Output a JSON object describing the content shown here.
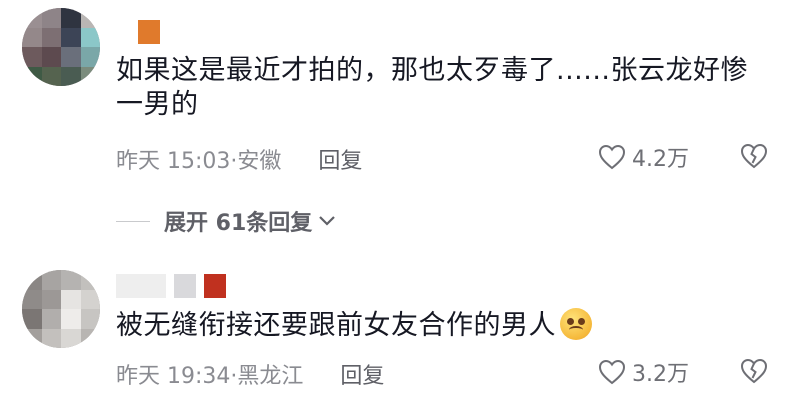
{
  "comments": [
    {
      "text": "如果这是最近才拍的，那也太歹毒了......张云龙好惨一男的",
      "time_location": "昨天 15:03·安徽",
      "reply_label": "回复",
      "likes": "4.2万"
    },
    {
      "text": "被无缝衔接还要跟前女友合作的男人",
      "time_location": "昨天 19:34·黑龙江",
      "reply_label": "回复",
      "likes": "3.2万"
    }
  ],
  "expand_replies": "展开 61条回复",
  "icons": {
    "like": "heart-outline-icon",
    "dislike": "broken-heart-icon",
    "expand": "chevron-down-icon",
    "emoji": "pleading-face-emoji"
  },
  "colors": {
    "text": "#161823",
    "meta": "#8a8b91",
    "accent_block": "#e07a2c",
    "red_block": "#c0311f"
  }
}
